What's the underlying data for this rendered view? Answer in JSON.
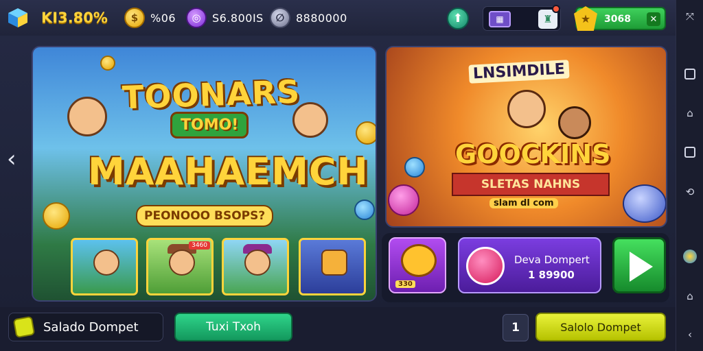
{
  "header": {
    "brand": "KI3.80%",
    "coins": "%06",
    "gems": "S6.800IS",
    "silver": "8880000",
    "wallet_value": "3068"
  },
  "banners": {
    "left": {
      "title_top": "TOONARS",
      "badge": "TOMO!",
      "title_main": "MAAHAEMCH",
      "subtitle": "PEONOOO BSOPS?",
      "thumb_badges": [
        "",
        "3460",
        "",
        ""
      ]
    },
    "right": {
      "top_label": "LNSIMDILE",
      "title": "GOOCKINS",
      "ribbon": "SLETAS NAHNS",
      "small": "slam dl com"
    }
  },
  "tiles": {
    "a_value": "330",
    "b_line1": "Deva Dompert",
    "b_line2": "1 89900"
  },
  "bottom": {
    "left_button": "Salado Dompet",
    "green_button": "Tuxi Txoh",
    "count": "1",
    "yellow_button": "Salolo Dompet"
  },
  "colors": {
    "accent_gold": "#ffd43b",
    "wallet_green": "#2fb54a",
    "play_green": "#2fcf4a",
    "purple": "#7b3de0"
  }
}
